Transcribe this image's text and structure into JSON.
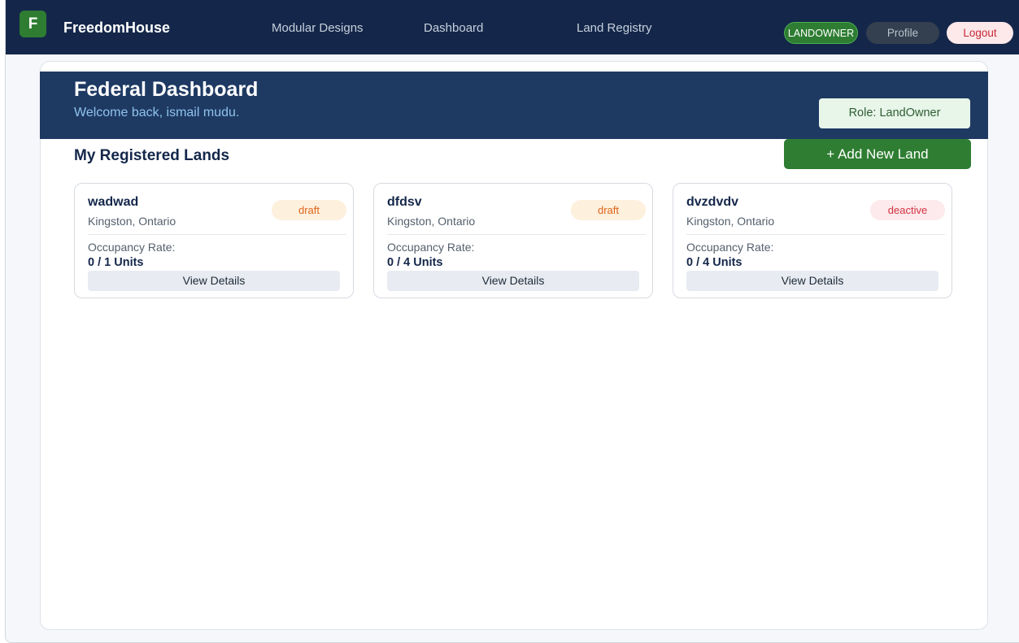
{
  "topnav": {
    "logo_letter": "F",
    "brand": "FreedomHouse",
    "links": [
      "Modular Designs",
      "Dashboard",
      "Land Registry"
    ],
    "role_badge": "LANDOWNER",
    "profile": "Profile",
    "logout": "Logout"
  },
  "banner": {
    "title": "Federal Dashboard",
    "welcome": "Welcome back, ismail mudu.",
    "role_chip": "Role: LandOwner"
  },
  "section": {
    "title": "My Registered Lands",
    "add_button": "+ Add New Land"
  },
  "lands": [
    {
      "name": "wadwad",
      "location": "Kingston, Ontario",
      "status": "draft",
      "occupancy_label": "Occupancy Rate:",
      "occupancy": "0 / 1 Units",
      "action": "View Details"
    },
    {
      "name": "dfdsv",
      "location": "Kingston, Ontario",
      "status": "draft",
      "occupancy_label": "Occupancy Rate:",
      "occupancy": "0 / 4 Units",
      "action": "View Details"
    },
    {
      "name": "dvzdvdv",
      "location": "Kingston, Ontario",
      "status": "deactive",
      "occupancy_label": "Occupancy Rate:",
      "occupancy": "0 / 4 Units",
      "action": "View Details"
    }
  ],
  "colors": {
    "nav_bg": "#14274a",
    "banner_bg": "#1e3a63",
    "accent_green": "#2e7d32",
    "draft": "#e0641b",
    "deactive": "#d23241"
  }
}
